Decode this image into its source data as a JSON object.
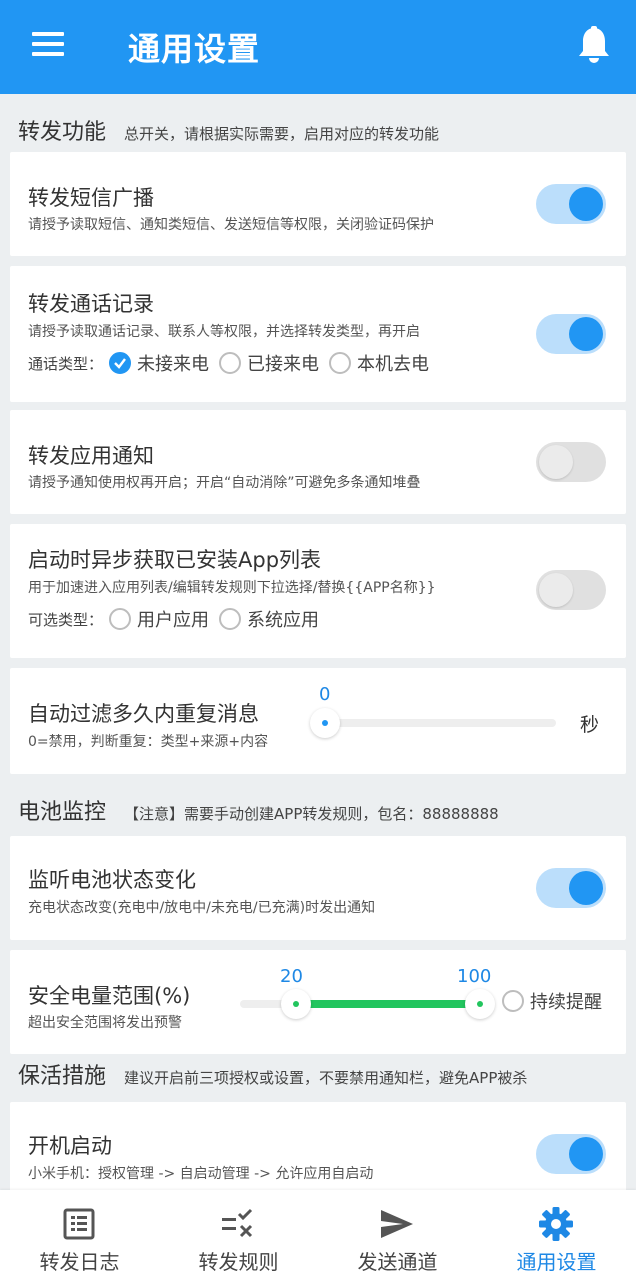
{
  "app_bar": {
    "title": "通用设置"
  },
  "sections": {
    "forward": {
      "title": "转发功能",
      "note": "总开关，请根据实际需要，启用对应的转发功能"
    },
    "battery": {
      "title": "电池监控",
      "note": "【注意】需要手动创建APP转发规则，包名：88888888"
    },
    "keepalive": {
      "title": "保活措施",
      "note": "建议开启前三项授权或设置，不要禁用通知栏，避免APP被杀"
    }
  },
  "cards": {
    "sms": {
      "title": "转发短信广播",
      "desc": "请授予读取短信、通知类短信、发送短信等权限，关闭验证码保护",
      "enabled": true
    },
    "calls": {
      "title": "转发通话记录",
      "desc": "请授予读取通话记录、联系人等权限，并选择转发类型，再开启",
      "enabled": true,
      "type_label": "通话类型：",
      "options": [
        {
          "label": "未接来电",
          "checked": true
        },
        {
          "label": "已接来电",
          "checked": false
        },
        {
          "label": "本机去电",
          "checked": false
        }
      ]
    },
    "app_notify": {
      "title": "转发应用通知",
      "desc": "请授予通知使用权再开启；开启“自动消除”可避免多条通知堆叠",
      "enabled": false
    },
    "app_list": {
      "title": "启动时异步获取已安装App列表",
      "desc": "用于加速进入应用列表/编辑转发规则下拉选择/替换{{APP名称}}",
      "enabled": false,
      "type_label": "可选类型：",
      "options": [
        {
          "label": "用户应用",
          "checked": false
        },
        {
          "label": "系统应用",
          "checked": false
        }
      ]
    },
    "dedupe": {
      "title": "自动过滤多久内重复消息",
      "desc": "0=禁用，判断重复：类型+来源+内容",
      "value": "0",
      "unit": "秒",
      "level": 0
    },
    "battery_change": {
      "title": "监听电池状态变化",
      "desc": "充电状态改变(充电中/放电中/未充电/已充满)时发出通知",
      "enabled": true
    },
    "battery_range": {
      "title": "安全电量范围(%)",
      "desc": "超出安全范围将发出预警",
      "min": "20",
      "max": "100",
      "min_value": 20,
      "max_value": 100,
      "persist_label": "持续提醒",
      "persist_checked": false
    },
    "boot": {
      "title": "开机启动",
      "desc": "小米手机：授权管理 -> 自启动管理 -> 允许应用自启动",
      "enabled": true
    }
  },
  "bottom_nav": [
    {
      "label": "转发日志",
      "icon": "list-alt-icon",
      "active": false
    },
    {
      "label": "转发规则",
      "icon": "rule-icon",
      "active": false
    },
    {
      "label": "发送通道",
      "icon": "send-icon",
      "active": false
    },
    {
      "label": "通用设置",
      "icon": "gear-icon",
      "active": true
    }
  ],
  "colors": {
    "primary": "#2196f3",
    "switch_track_on": "#bbdefb",
    "range_fill": "#22c55e",
    "background": "#eceff1"
  }
}
